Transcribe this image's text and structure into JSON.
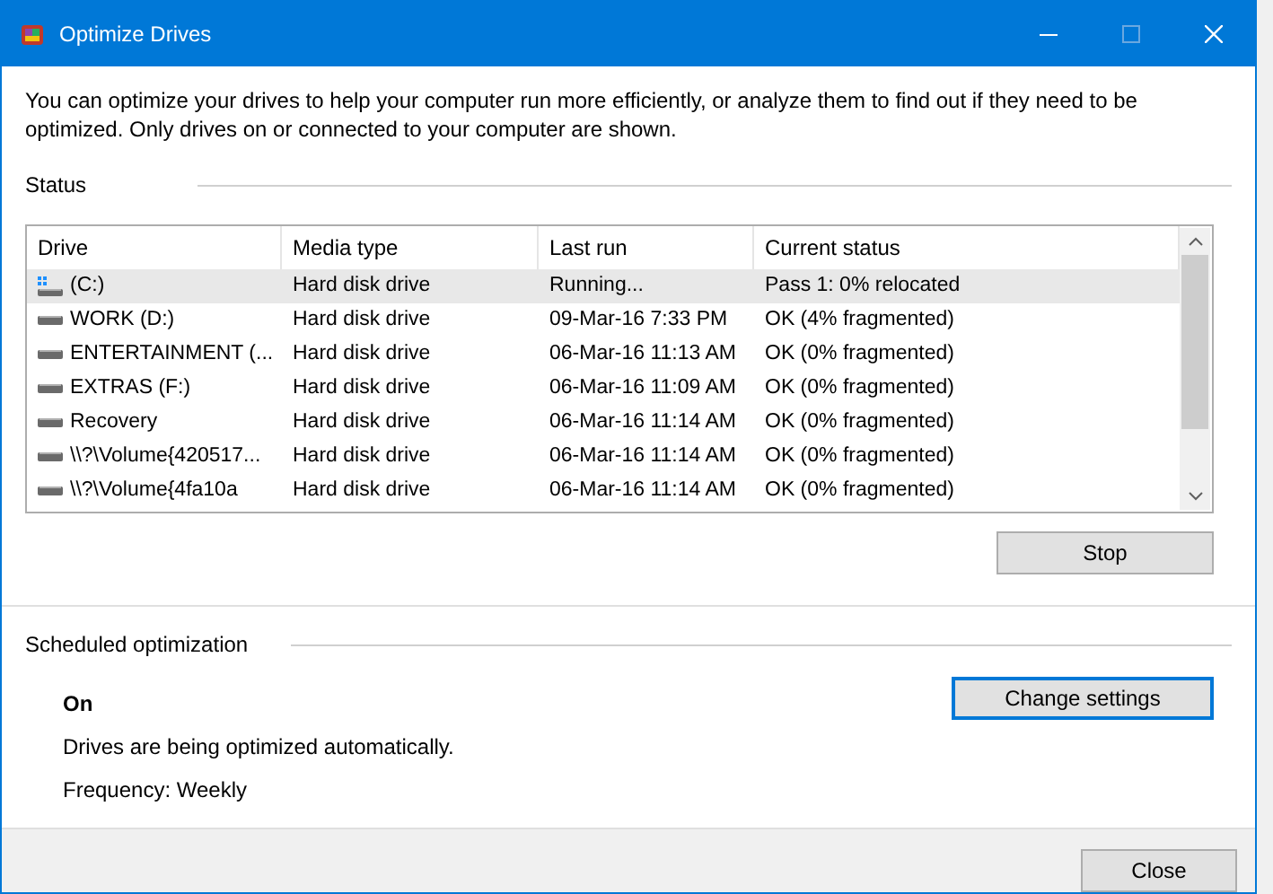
{
  "window": {
    "title": "Optimize Drives"
  },
  "description": "You can optimize your drives to help your computer run more efficiently, or analyze them to find out if they need to be optimized. Only drives on or connected to your computer are shown.",
  "status": {
    "heading": "Status",
    "table": {
      "columns": [
        "Drive",
        "Media type",
        "Last run",
        "Current status"
      ],
      "rows": [
        {
          "kind": "system",
          "selected": true,
          "cells": [
            "(C:)",
            "Hard disk drive",
            "Running...",
            "Pass 1: 0% relocated"
          ]
        },
        {
          "kind": "disk",
          "selected": false,
          "cells": [
            "WORK (D:)",
            "Hard disk drive",
            "09-Mar-16 7:33 PM",
            "OK (4% fragmented)"
          ]
        },
        {
          "kind": "disk",
          "selected": false,
          "cells": [
            "ENTERTAINMENT (...",
            "Hard disk drive",
            "06-Mar-16 11:13 AM",
            "OK (0% fragmented)"
          ]
        },
        {
          "kind": "disk",
          "selected": false,
          "cells": [
            "EXTRAS (F:)",
            "Hard disk drive",
            "06-Mar-16 11:09 AM",
            "OK (0% fragmented)"
          ]
        },
        {
          "kind": "disk",
          "selected": false,
          "cells": [
            "Recovery",
            "Hard disk drive",
            "06-Mar-16 11:14 AM",
            "OK (0% fragmented)"
          ]
        },
        {
          "kind": "disk",
          "selected": false,
          "cells": [
            "\\\\?\\Volume{420517...",
            "Hard disk drive",
            "06-Mar-16 11:14 AM",
            "OK (0% fragmented)"
          ]
        },
        {
          "kind": "disk",
          "selected": false,
          "cells": [
            "\\\\?\\Volume{4fa10a",
            "Hard disk drive",
            "06-Mar-16 11:14 AM",
            "OK (0% fragmented)"
          ]
        }
      ]
    },
    "button": "Stop"
  },
  "scheduled": {
    "heading": "Scheduled optimization",
    "state": "On",
    "description": "Drives are being optimized automatically.",
    "frequency": "Frequency: Weekly",
    "button": "Change settings"
  },
  "footer": {
    "button": "Close"
  }
}
